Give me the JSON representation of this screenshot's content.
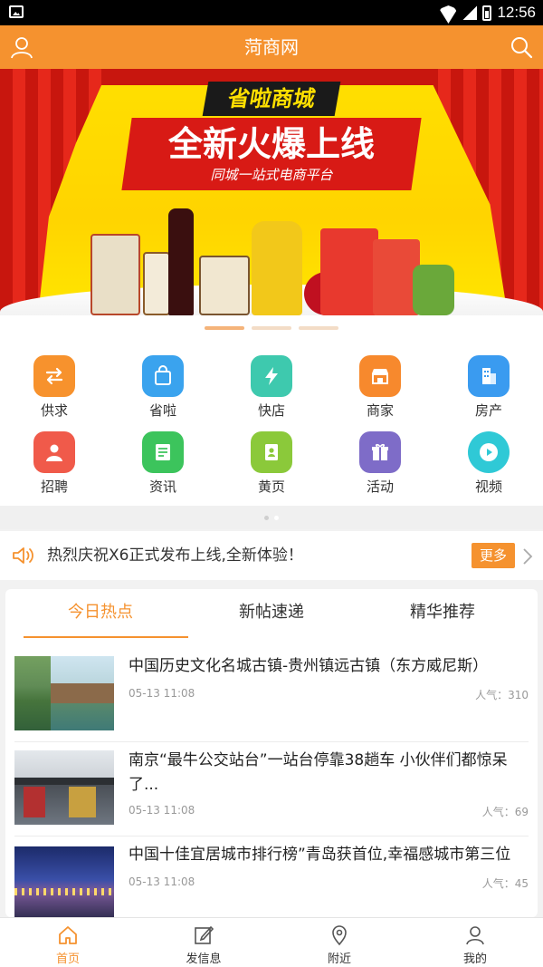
{
  "status_bar": {
    "time": "12:56"
  },
  "header": {
    "title": "菏商网"
  },
  "banner": {
    "brand": "省啦商城",
    "headline": "全新火爆上线",
    "tagline": "同城一站式电商平台",
    "slide_count": 3,
    "active_slide": 1
  },
  "categories": [
    {
      "label": "供求",
      "icon": "swap-arrows-icon",
      "color": "#f7922d"
    },
    {
      "label": "省啦",
      "icon": "shopping-bag-icon",
      "color": "#3aa3ee"
    },
    {
      "label": "快店",
      "icon": "lightning-icon",
      "color": "#3ec9ae"
    },
    {
      "label": "商家",
      "icon": "storefront-icon",
      "color": "#f7892d"
    },
    {
      "label": "房产",
      "icon": "building-icon",
      "color": "#3a9bf0"
    },
    {
      "label": "招聘",
      "icon": "person-icon",
      "color": "#f05a4a"
    },
    {
      "label": "资讯",
      "icon": "newspaper-icon",
      "color": "#3cc45c"
    },
    {
      "label": "黄页",
      "icon": "contacts-book-icon",
      "color": "#8bc93a"
    },
    {
      "label": "活动",
      "icon": "gift-icon",
      "color": "#7e6cc8"
    },
    {
      "label": "视频",
      "icon": "play-icon",
      "color": "#2fc9d6"
    }
  ],
  "notice": {
    "text": "热烈庆祝X6正式发布上线,全新体验！",
    "more_label": "更多"
  },
  "feed": {
    "tabs": [
      "今日热点",
      "新帖速递",
      "精华推荐"
    ],
    "active_tab": 0,
    "items": [
      {
        "title": "中国历史文化名城古镇-贵州镇远古镇（东方威尼斯）",
        "date": "05-13 11:08",
        "popularity": "人气：310"
      },
      {
        "title": "南京“最牛公交站台”一站台停靠38趟车 小伙伴们都惊呆了...",
        "date": "05-13 11:08",
        "popularity": "人气：69"
      },
      {
        "title": "中国十佳宜居城市排行榜”青岛获首位,幸福感城市第三位",
        "date": "05-13 11:08",
        "popularity": "人气：45"
      }
    ]
  },
  "bottom_nav": [
    {
      "label": "首页",
      "icon": "home-icon",
      "active": true
    },
    {
      "label": "发信息",
      "icon": "compose-icon",
      "active": false
    },
    {
      "label": "附近",
      "icon": "location-pin-icon",
      "active": false
    },
    {
      "label": "我的",
      "icon": "user-icon",
      "active": false
    }
  ],
  "colors": {
    "accent": "#f5922f",
    "header": "#f5922f"
  }
}
